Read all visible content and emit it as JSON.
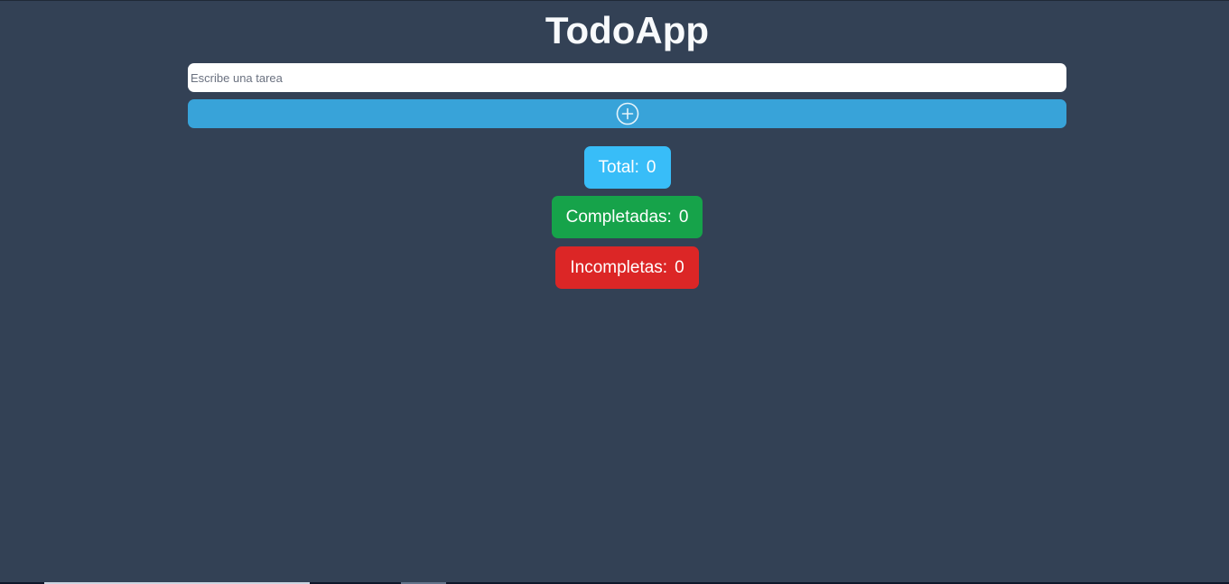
{
  "app": {
    "title": "TodoApp"
  },
  "input": {
    "placeholder": "Escribe una tarea",
    "value": ""
  },
  "add_button": {
    "icon": "plus-circle-icon"
  },
  "stats": {
    "total_label": "Total:",
    "total_value": "0",
    "completed_label": "Completadas:",
    "completed_value": "0",
    "incomplete_label": "Incompletas:",
    "incomplete_value": "0"
  },
  "colors": {
    "background": "#334155",
    "add_button": "#38a3d9",
    "total": "#38bdf8",
    "completed": "#16a34a",
    "incomplete": "#dc2626"
  }
}
